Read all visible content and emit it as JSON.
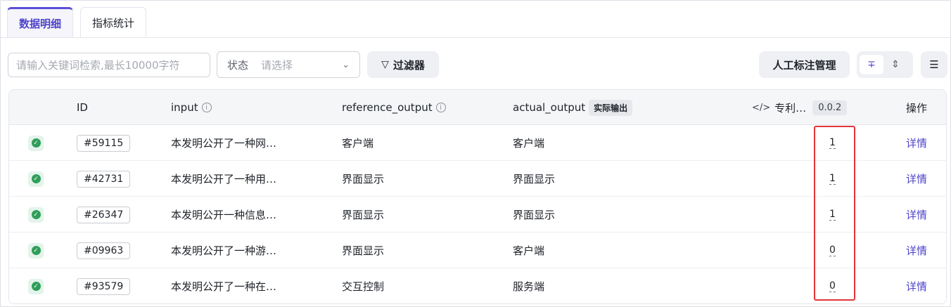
{
  "tabs": [
    {
      "label": "数据明细",
      "active": true
    },
    {
      "label": "指标统计",
      "active": false
    }
  ],
  "toolbar": {
    "search_placeholder": "请输入关键词检索,最长10000字符",
    "status_label": "状态",
    "status_placeholder": "请选择",
    "filter_label": "过滤器",
    "annotation_label": "人工标注管理"
  },
  "table": {
    "headers": {
      "id": "ID",
      "input": "input",
      "reference_output": "reference_output",
      "actual_output": "actual_output",
      "actual_output_tag": "实际输出",
      "evaluator": "专利…",
      "evaluator_version": "0.0.2",
      "actions": "操作"
    },
    "rows": [
      {
        "id": "#59115",
        "input": "本发明公开了一种网…",
        "reference_output": "客户端",
        "actual_output": "客户端",
        "score": "1",
        "action": "详情"
      },
      {
        "id": "#42731",
        "input": "本发明公开了一种用…",
        "reference_output": "界面显示",
        "actual_output": "界面显示",
        "score": "1",
        "action": "详情"
      },
      {
        "id": "#26347",
        "input": "本发明公开一种信息…",
        "reference_output": "界面显示",
        "actual_output": "界面显示",
        "score": "1",
        "action": "详情"
      },
      {
        "id": "#09963",
        "input": "本发明公开了一种游…",
        "reference_output": "界面显示",
        "actual_output": "客户端",
        "score": "0",
        "action": "详情"
      },
      {
        "id": "#93579",
        "input": "本发明公开了一种在…",
        "reference_output": "交互控制",
        "actual_output": "服务端",
        "score": "0",
        "action": "详情"
      }
    ]
  },
  "colors": {
    "accent": "#4e44c9",
    "status_ok": "#2f9e5a",
    "highlight": "#e0353b"
  },
  "icons": [
    "filter-icon",
    "chevron-down-icon",
    "collapse-icon",
    "expand-icon",
    "column-settings-icon",
    "info-icon",
    "code-icon",
    "check-circle-icon"
  ]
}
